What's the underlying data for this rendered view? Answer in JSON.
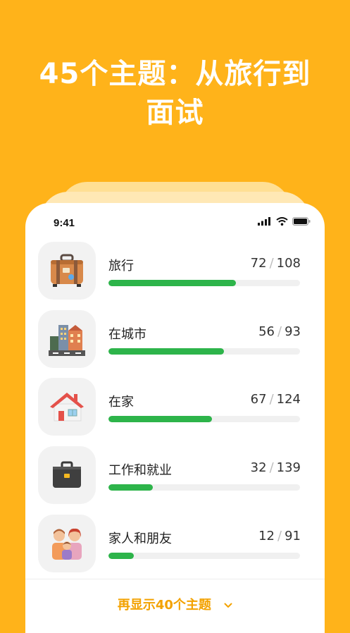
{
  "headline": {
    "line1": "45个主题：从旅行到",
    "line2": "面试"
  },
  "status_bar": {
    "time": "9:41",
    "icons": [
      "signal-icon",
      "wifi-icon",
      "battery-icon"
    ]
  },
  "topics": [
    {
      "label": "旅行",
      "done": "72",
      "total": "108",
      "progress": 0.667,
      "icon": "suitcase-icon"
    },
    {
      "label": "在城市",
      "done": "56",
      "total": "93",
      "progress": 0.602,
      "icon": "city-icon"
    },
    {
      "label": "在家",
      "done": "67",
      "total": "124",
      "progress": 0.54,
      "icon": "house-icon"
    },
    {
      "label": "工作和就业",
      "done": "32",
      "total": "139",
      "progress": 0.23,
      "icon": "briefcase-icon"
    },
    {
      "label": "家人和朋友",
      "done": "12",
      "total": "91",
      "progress": 0.132,
      "icon": "family-icon"
    }
  ],
  "count_separator": "/",
  "show_more": {
    "label": "再显示40个主题",
    "icon": "chevron-down-icon"
  },
  "colors": {
    "background": "#FFB31A",
    "progress": "#2DB44A",
    "link": "#F3A200"
  }
}
